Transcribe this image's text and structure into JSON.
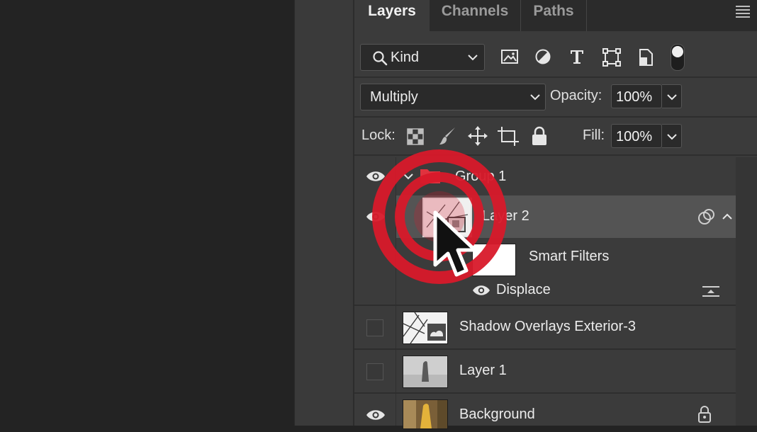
{
  "tabs": [
    {
      "label": "Layers",
      "active": true
    },
    {
      "label": "Channels",
      "active": false
    },
    {
      "label": "Paths",
      "active": false
    }
  ],
  "filter": {
    "kind_label": "Kind"
  },
  "blend": {
    "mode": "Multiply",
    "opacity_label": "Opacity:",
    "opacity_value": "100%"
  },
  "lock": {
    "label": "Lock:",
    "fill_label": "Fill:",
    "fill_value": "100%"
  },
  "layers": {
    "group": {
      "name": "Group 1"
    },
    "layer2": {
      "name": "Layer 2"
    },
    "smart_filters": {
      "label": "Smart Filters"
    },
    "displace": {
      "name": "Displace"
    },
    "shadow": {
      "name": "Shadow Overlays Exterior-3"
    },
    "layer1": {
      "name": "Layer 1"
    },
    "background": {
      "name": "Background"
    }
  },
  "colors": {
    "accent_red": "#d8192a",
    "folder_red": "#e0323e",
    "selected_row": "#545454",
    "panel_bg": "#3b3b3b"
  }
}
